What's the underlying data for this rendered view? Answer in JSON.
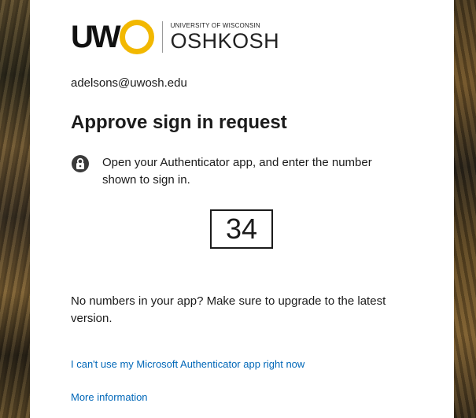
{
  "brand": {
    "logo_letters": "UW",
    "logo_subtitle": "UNIVERSITY OF WISCONSIN",
    "logo_name": "OSHKOSH",
    "accent_color": "#f2b800"
  },
  "account": {
    "email": "adelsons@uwosh.edu"
  },
  "page": {
    "title": "Approve sign in request",
    "instruction": "Open your Authenticator app, and enter the number shown to sign in.",
    "instruction_icon": "authenticator-lock-icon",
    "number": "34",
    "note": "No numbers in your app? Make sure to upgrade to the latest version."
  },
  "links": {
    "cant_use": "I can't use my Microsoft Authenticator app right now",
    "more_info": "More information",
    "link_color": "#0067b8"
  }
}
